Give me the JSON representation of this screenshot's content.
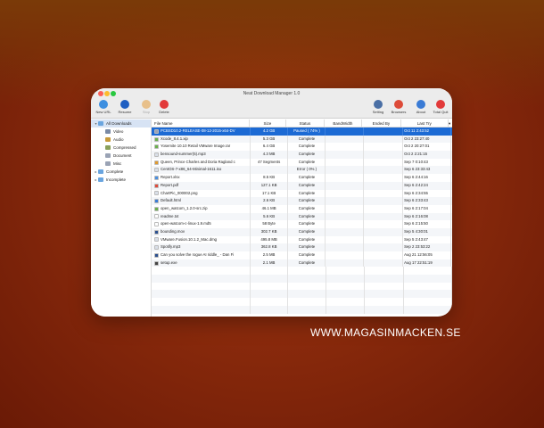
{
  "window": {
    "title": "Neat Download Manager 1.0"
  },
  "toolbar": {
    "buttons": [
      {
        "label": "New URL",
        "color": "#3d8fe0",
        "disabled": false
      },
      {
        "label": "Resume",
        "color": "#1f5fc2",
        "disabled": false
      },
      {
        "label": "Stop",
        "color": "#e8c08a",
        "disabled": true
      },
      {
        "label": "Delete",
        "color": "#e23a3a",
        "disabled": false
      }
    ],
    "right_buttons": [
      {
        "label": "Setting",
        "color": "#4a6fa5"
      },
      {
        "label": "Browsers",
        "color": "#dd4b39"
      },
      {
        "label": "About",
        "color": "#3a7bd5"
      },
      {
        "label": "Total Quit",
        "color": "#e23a3a"
      }
    ]
  },
  "sidebar": {
    "items": [
      {
        "label": "All Downloads",
        "arrow": "▾",
        "level": 0,
        "selected": true
      },
      {
        "label": "Video",
        "arrow": "",
        "level": 1,
        "selected": false
      },
      {
        "label": "Audio",
        "arrow": "",
        "level": 1,
        "selected": false
      },
      {
        "label": "Compressed",
        "arrow": "",
        "level": 1,
        "selected": false
      },
      {
        "label": "Document",
        "arrow": "",
        "level": 1,
        "selected": false
      },
      {
        "label": "Misc",
        "arrow": "",
        "level": 1,
        "selected": false
      },
      {
        "label": "Complete",
        "arrow": "▸",
        "level": 0,
        "selected": false
      },
      {
        "label": "Incomplete",
        "arrow": "▸",
        "level": 0,
        "selected": false
      }
    ]
  },
  "table": {
    "headers": [
      "File Name",
      "Size",
      "Status",
      "BandWidth",
      "Ended By",
      "Last Try"
    ],
    "sort_indicator": "▾",
    "rows": [
      {
        "name": "PCBSD10.2-RELEASE-08-12-2015-x64-DV",
        "size": "4.2 GB",
        "status": "Paused ( 74% )",
        "bandwidth": "",
        "ended": "",
        "last": "Oct 11  2:43:52",
        "icon": "#9aa3b5"
      },
      {
        "name": "Xcode_8.4.1.xip",
        "size": "5.3 GB",
        "status": "Complete",
        "bandwidth": "",
        "ended": "",
        "last": "Oct 2  23:27:40",
        "icon": "#6ab04c"
      },
      {
        "name": "Yosemite 10.10 Retail VMware Image.rar",
        "size": "6.4 GB",
        "status": "Complete",
        "bandwidth": "",
        "ended": "",
        "last": "Oct 2  20:27:01",
        "icon": "#6ab04c"
      },
      {
        "name": "bensound-summer(5).mp3",
        "size": "4.3 MB",
        "status": "Complete",
        "bandwidth": "",
        "ended": "",
        "last": "Oct 2  2:21:15",
        "icon": "#d9dfe8"
      },
      {
        "name": "Queen, Prince Charles and Doria Ragland c",
        "size": "47 Segments",
        "status": "Complete",
        "bandwidth": "",
        "ended": "",
        "last": "Sep 7  0:10:43",
        "icon": "#e09a2f"
      },
      {
        "name": "CentOS-7-x86_64-Minimal-1611.iso",
        "size": "",
        "status": "Error ( 0% )",
        "bandwidth": "",
        "ended": "",
        "last": "Sep 6  23:33:43",
        "icon": "#d9dfe8"
      },
      {
        "name": "Report.xlsx",
        "size": "8.5 KB",
        "status": "Complete",
        "bandwidth": "",
        "ended": "",
        "last": "Sep 6  2:44:16",
        "icon": "#4a8fe0"
      },
      {
        "name": "Report.pdf",
        "size": "127.1 KB",
        "status": "Complete",
        "bandwidth": "",
        "ended": "",
        "last": "Sep 6  2:42:24",
        "icon": "#e04a3a"
      },
      {
        "name": "ChartPic_000002.png",
        "size": "17.1 KB",
        "status": "Complete",
        "bandwidth": "",
        "ended": "",
        "last": "Sep 6  2:34:55",
        "icon": "#d9dfe8"
      },
      {
        "name": "Default.html",
        "size": "2.6 KB",
        "status": "Complete",
        "bandwidth": "",
        "ended": "",
        "last": "Sep 6  2:33:43",
        "icon": "#3a7bd5"
      },
      {
        "name": "open_watcom_1.2.0-src.zip",
        "size": "46.1 MB",
        "status": "Complete",
        "bandwidth": "",
        "ended": "",
        "last": "Sep 6  2:17:04",
        "icon": "#6ab04c"
      },
      {
        "name": "readme.txt",
        "size": "5.6 KB",
        "status": "Complete",
        "bandwidth": "",
        "ended": "",
        "last": "Sep 6  2:16:08",
        "icon": "#ffffff"
      },
      {
        "name": "open-watcom-c-linux-1.9.md5",
        "size": "58 Byte",
        "status": "Complete",
        "bandwidth": "",
        "ended": "",
        "last": "Sep 6  2:15:50",
        "icon": "#ffffff"
      },
      {
        "name": "bounding.mov",
        "size": "302.7 KB",
        "status": "Complete",
        "bandwidth": "",
        "ended": "",
        "last": "Sep 5  4:30:01",
        "icon": "#2a4f8f"
      },
      {
        "name": "VMware.Fusion.10.1.2_Mac.dmg",
        "size": "495.8 MB",
        "status": "Complete",
        "bandwidth": "",
        "ended": "",
        "last": "Sep 5  2:43:47",
        "icon": "#d9dfe8"
      },
      {
        "name": "Spotify.mp3",
        "size": "362.8 KB",
        "status": "Complete",
        "bandwidth": "",
        "ended": "",
        "last": "Sep 2  23:53:22",
        "icon": "#d9dfe8"
      },
      {
        "name": "Can you solve the rogue AI riddle_ - Dan Fi",
        "size": "2.5 MB",
        "status": "Complete",
        "bandwidth": "",
        "ended": "",
        "last": "Aug 21  12:56:05",
        "icon": "#2a4f8f"
      },
      {
        "name": "setup.exe",
        "size": "2.1 MB",
        "status": "Complete",
        "bandwidth": "",
        "ended": "",
        "last": "Aug 17  22:51:19",
        "icon": "#444444"
      }
    ],
    "selected_index": 0
  },
  "watermark": "WWW.MAGASINMACKEN.SE"
}
